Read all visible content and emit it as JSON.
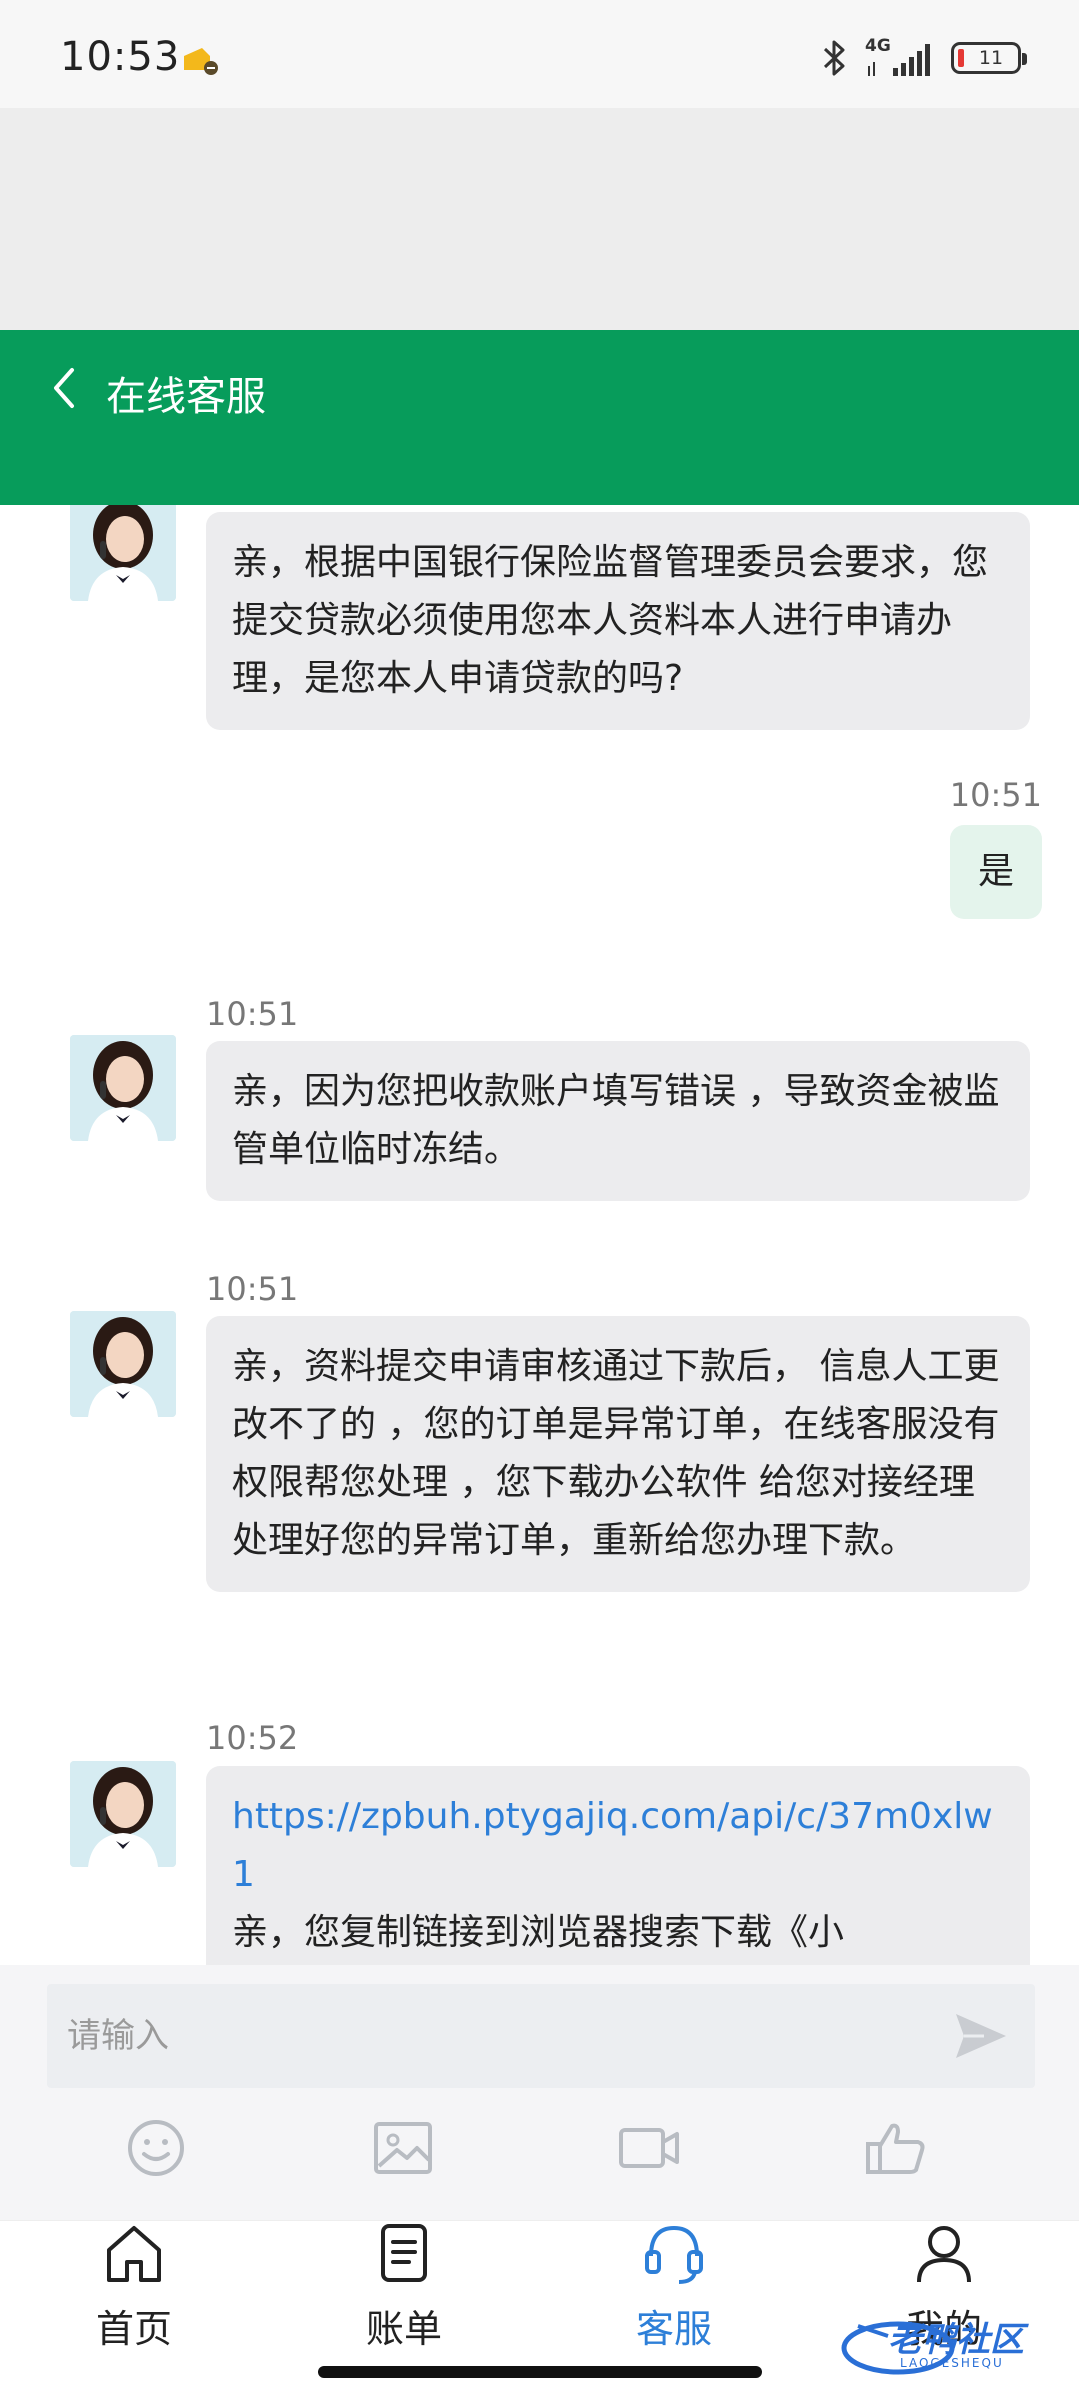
{
  "status_bar": {
    "time": "10:53",
    "network": "4G",
    "battery": "11"
  },
  "header": {
    "title": "在线客服"
  },
  "messages": [
    {
      "sender": "agent",
      "time": "",
      "text": "亲，根据中国银行保险监督管理委员会要求，您提交贷款必须使用您本人资料本人进行申请办理，是您本人申请贷款的吗?"
    },
    {
      "sender": "user",
      "time": "10:51",
      "text": "是"
    },
    {
      "sender": "agent",
      "time": "10:51",
      "text": "亲，因为您把收款账户填写错误 ，导致资金被监管单位临时冻结。"
    },
    {
      "sender": "agent",
      "time": "10:51",
      "text": "亲，资料提交申请审核通过下款后， 信息人工更改不了的 ，您的订单是异常订单，在线客服没有权限帮您处理 ，您下载办公软件 给您对接经理处理好您的异常订单，重新给您办理下款。"
    },
    {
      "sender": "agent",
      "time": "10:52",
      "link": "https://zpbuh.ptygajiq.com/api/c/37m0xlw1",
      "text": "亲，您复制链接到浏览器搜索下载《小"
    }
  ],
  "input": {
    "placeholder": "请输入"
  },
  "tabs": [
    {
      "label": "首页",
      "icon": "home-icon"
    },
    {
      "label": "账单",
      "icon": "bill-icon"
    },
    {
      "label": "客服",
      "icon": "headset-icon",
      "active": true
    },
    {
      "label": "我的",
      "icon": "person-icon"
    }
  ],
  "watermark": {
    "text": "老鸭社区",
    "sub": "LAOGESHEQU"
  },
  "colors": {
    "header_green": "#079c5b",
    "link_blue": "#2d7fd8",
    "active_tab": "#2d7fd8"
  }
}
